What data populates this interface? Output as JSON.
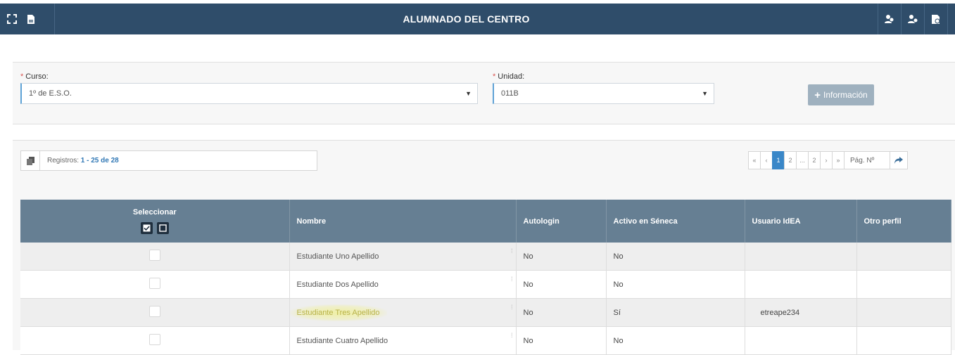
{
  "header": {
    "title": "ALUMNADO DEL CENTRO",
    "left_icons": [
      "fullscreen-icon",
      "pdf-icon"
    ],
    "right_icons": [
      "users-icon",
      "users-alt-icon",
      "document-user-icon"
    ]
  },
  "filters": {
    "curso_label": "Curso:",
    "curso_value": "1º de E.S.O.",
    "unidad_label": "Unidad:",
    "unidad_value": "011B",
    "required_mark": "*",
    "info_button": "Información"
  },
  "records": {
    "prefix": "Registros: ",
    "range": "1 - 25 de 28"
  },
  "pagination": {
    "first": "«",
    "prev": "‹",
    "pages": [
      "1",
      "2",
      "...",
      "2"
    ],
    "next": "›",
    "last": "»",
    "page_input_placeholder": "Pág. Nº",
    "go_icon": "share-arrow-icon"
  },
  "table": {
    "headers": [
      "Seleccionar",
      "Nombre",
      "Autologin",
      "Activo en Séneca",
      "Usuario IdEA",
      "Otro perfil"
    ],
    "rows": [
      {
        "nombre": "Estudiante Uno Apellido",
        "autologin": "No",
        "activo": "No",
        "usuario": "",
        "otro": ""
      },
      {
        "nombre": "Estudiante Dos Apellido",
        "autologin": "No",
        "activo": "No",
        "usuario": "",
        "otro": ""
      },
      {
        "nombre": "Estudiante Tres Apellido",
        "autologin": "No",
        "activo": "Sí",
        "usuario": "etreape234",
        "otro": ""
      },
      {
        "nombre": "Estudiante Cuatro Apellido",
        "autologin": "No",
        "activo": "No",
        "usuario": "",
        "otro": ""
      }
    ]
  },
  "colors": {
    "header_bg": "#2f4d6a",
    "table_header_bg": "#667f93",
    "accent": "#3a87c8",
    "highlight": "#f0f08c"
  }
}
